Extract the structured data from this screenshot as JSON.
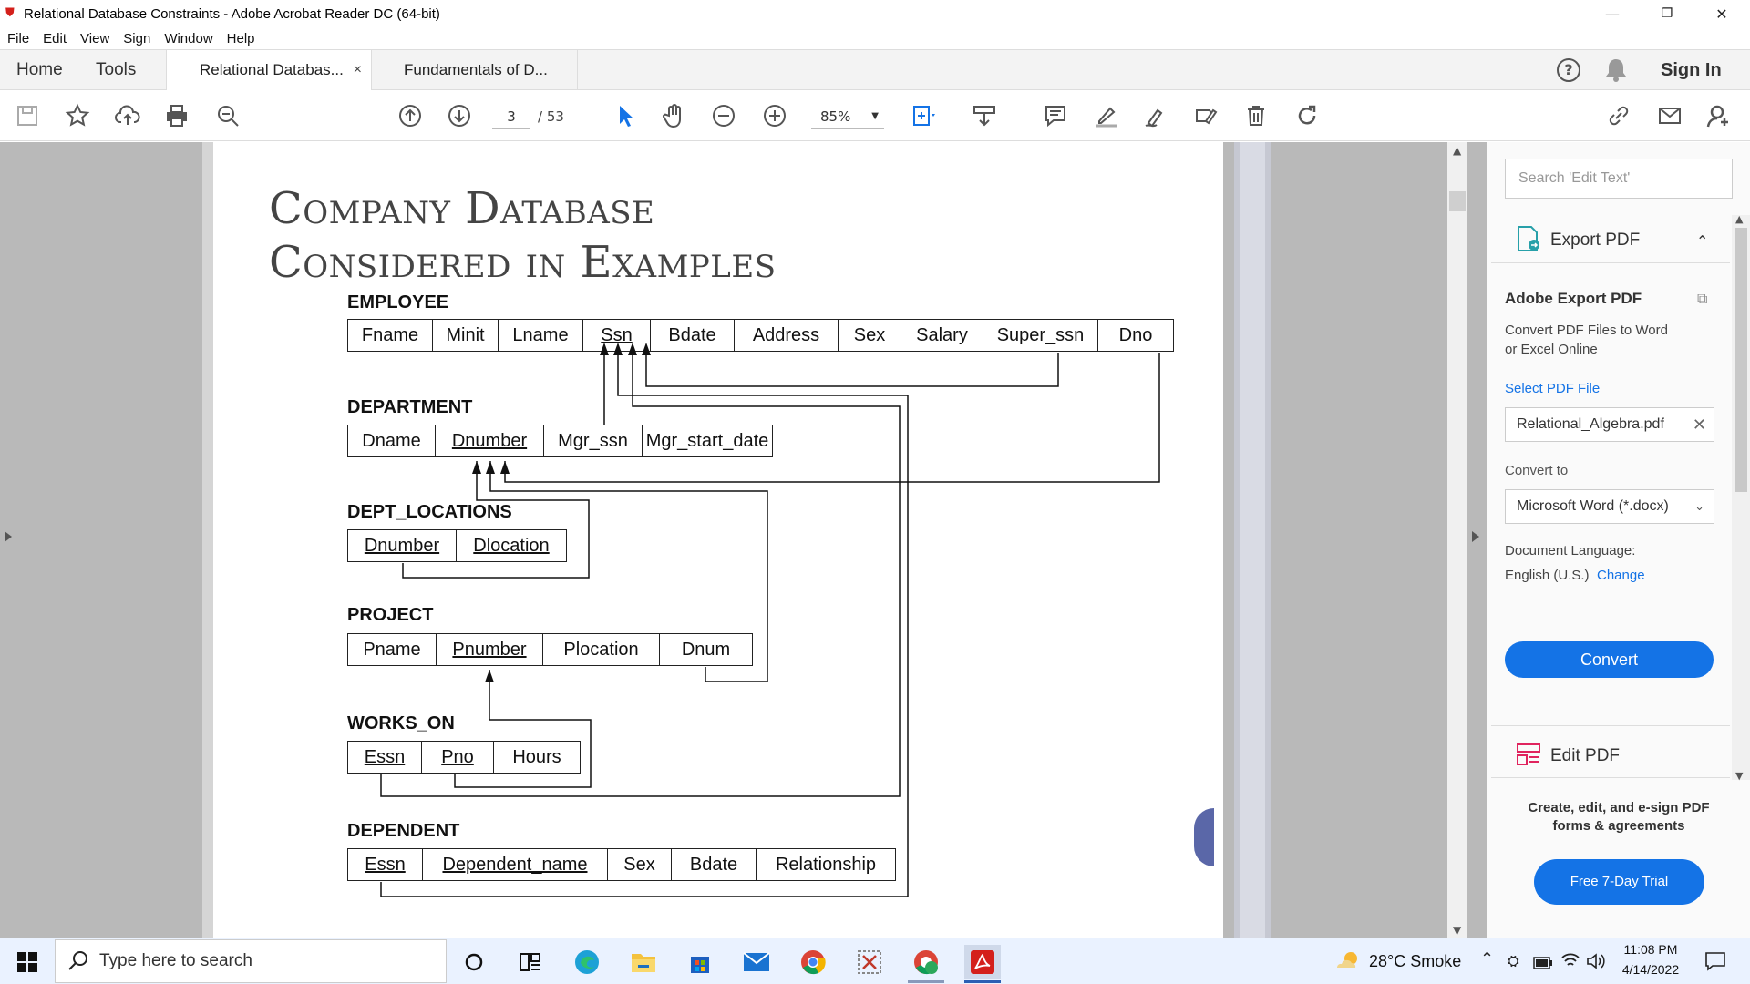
{
  "window": {
    "title": "Relational Database Constraints - Adobe Acrobat Reader DC (64-bit)",
    "minimize": "—",
    "restore": "❐",
    "close": "✕"
  },
  "menu": [
    "File",
    "Edit",
    "View",
    "Sign",
    "Window",
    "Help"
  ],
  "nav": {
    "home": "Home",
    "tools": "Tools",
    "help_icon": "?",
    "sign_in": "Sign In"
  },
  "tabs": [
    {
      "label": "Relational Databas...",
      "close": "×"
    },
    {
      "label": "Fundamentals of D..."
    }
  ],
  "toolbar": {
    "page_current": "3",
    "page_total": "/ 53",
    "zoom": "85%"
  },
  "document": {
    "title_line1": "Company Database",
    "title_line2": "Considered in Examples",
    "relations": {
      "employee": {
        "name": "EMPLOYEE",
        "attrs": [
          "Fname",
          "Minit",
          "Lname",
          "Ssn",
          "Bdate",
          "Address",
          "Sex",
          "Salary",
          "Super_ssn",
          "Dno"
        ]
      },
      "department": {
        "name": "DEPARTMENT",
        "attrs": [
          "Dname",
          "Dnumber",
          "Mgr_ssn",
          "Mgr_start_date"
        ]
      },
      "dept_locations": {
        "name": "DEPT_LOCATIONS",
        "attrs": [
          "Dnumber",
          "Dlocation"
        ]
      },
      "project": {
        "name": "PROJECT",
        "attrs": [
          "Pname",
          "Pnumber",
          "Plocation",
          "Dnum"
        ]
      },
      "works_on": {
        "name": "WORKS_ON",
        "attrs": [
          "Essn",
          "Pno",
          "Hours"
        ]
      },
      "dependent": {
        "name": "DEPENDENT",
        "attrs": [
          "Essn",
          "Dependent_name",
          "Sex",
          "Bdate",
          "Relationship"
        ]
      }
    }
  },
  "side_panel": {
    "search_placeholder": "Search 'Edit Text'",
    "export_title": "Export PDF",
    "export_heading": "Adobe Export PDF",
    "export_desc_1": "Convert PDF Files to Word",
    "export_desc_2": "or Excel Online",
    "select_file": "Select PDF File",
    "file_name": "Relational_Algebra.pdf",
    "convert_to": "Convert to",
    "format": "Microsoft Word (*.docx)",
    "doc_lang_label": "Document Language:",
    "doc_lang": "English (U.S.)",
    "change": "Change",
    "convert_button": "Convert",
    "edit_title": "Edit PDF",
    "edit_desc_1": "Create, edit, and e-sign PDF",
    "edit_desc_2": "forms & agreements",
    "trial_button": "Free 7-Day Trial"
  },
  "taskbar": {
    "search_placeholder": "Type here to search",
    "weather": "28°C  Smoke",
    "time": "11:08 PM",
    "date": "4/14/2022"
  }
}
